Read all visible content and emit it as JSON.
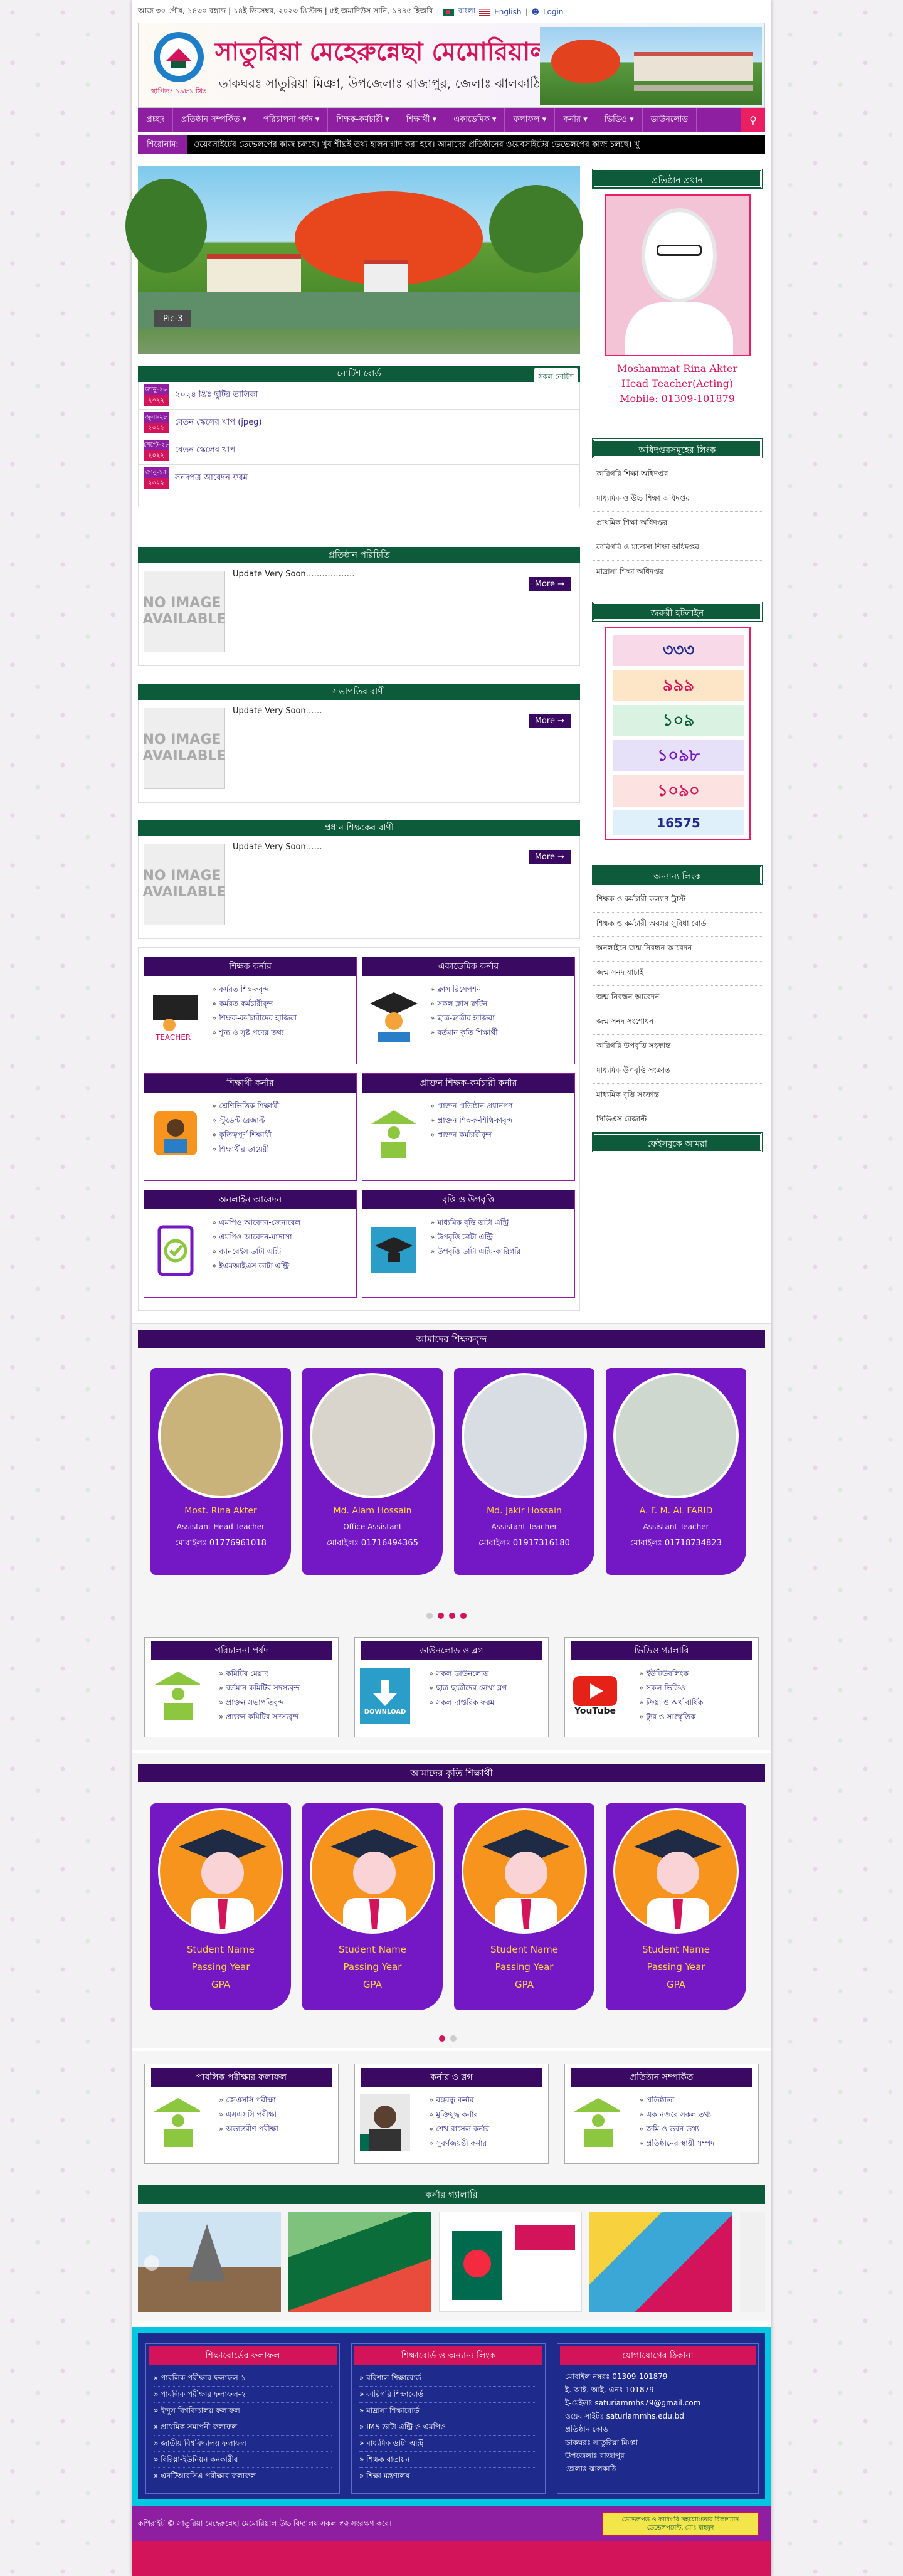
{
  "topbar": {
    "date_text": "আজ ৩০ পৌষ, ১৪৩০ বঙ্গাব্দ | ১৪ই ডিসেম্বর, ২০২৩ খ্রিস্টাব্দ | ৫ই জমাদিউস সানি, ১৪৪৫ হিজরি",
    "lang_bangla": "বাংলা",
    "lang_english": "English",
    "login": "Login"
  },
  "header": {
    "school_name": "সাতুরিয়া মেহেরুন্নেছা মেমোরিয়াল উচ্চ বিদ্যালয়",
    "address": "ডাকঘরঃ সাতুরিয়া মিঞা, উপজেলাঃ রাজাপুর, জেলাঃ ঝালকাঠি",
    "estd": "স্থাপিতঃ ১৯৮১ খ্রিঃ"
  },
  "nav": {
    "items": [
      "প্রচ্ছদ",
      "প্রতিষ্ঠান সম্পর্কিত ▾",
      "পরিচালনা পর্ষদ ▾",
      "শিক্ষক-কর্মচারী ▾",
      "শিক্ষার্থী ▾",
      "একাডেমিক ▾",
      "ফলাফল ▾",
      "কর্নার ▾",
      "ভিডিও ▾",
      "ডাউনলোড"
    ]
  },
  "ticker": {
    "label": "শিরোনাম:",
    "text": "ওয়েবসাইটের ডেভেলপের কাজ চলছে। খুব শীঘ্রই তথ্য হালনাগাদ করা হবে।        আমাদের প্রতিষ্ঠানের ওয়েবসাইটের ডেভেলপের কাজ চলছে। খু"
  },
  "slider": {
    "caption": "Pic-3"
  },
  "notice": {
    "title": "নোটিশ বোর্ড",
    "all_label": "সকল নোটিশ",
    "items": [
      {
        "day": "জানু-২৮",
        "year": "২০২২",
        "title": "২০২৪ খ্রিঃ ছুটির তালিকা"
      },
      {
        "day": "জুলা-২৮",
        "year": "২০২২",
        "title": "বেতন স্কেলের খাপ (jpeg)"
      },
      {
        "day": "সেপ্টে-২৮",
        "year": "২০২২",
        "title": "বেতন স্কেলের খাপ"
      },
      {
        "day": "জানু-১৫",
        "year": "২০২২",
        "title": "সনদপত্র আবেদন ফরম"
      }
    ]
  },
  "intro_blocks": [
    {
      "title": "প্রতিষ্ঠান পরিচিতি",
      "text": "Update Very Soon………………",
      "more": "More →",
      "noimg": "NO IMAGE AVAILABLE"
    },
    {
      "title": "সভাপতির বাণী",
      "text": "Update Very Soon……",
      "more": "More →",
      "noimg": "NO IMAGE AVAILABLE"
    },
    {
      "title": "প্রধান শিক্ষকের বাণী",
      "text": "Update Very Soon……",
      "more": "More →",
      "noimg": "NO IMAGE AVAILABLE"
    }
  ],
  "sidebar": {
    "head_title": "প্রতিষ্ঠান প্রধান",
    "head_name": "Moshammat Rina Akter",
    "head_role": "Head Teacher(Acting)",
    "head_mobile": "Mobile: 01309-101879",
    "links_title": "অধিদপ্তরসমূহের লিংক",
    "links": [
      "কারিগরি শিক্ষা অধিদপ্তর",
      "মাধ্যমিক ও উচ্চ শিক্ষা অধিদপ্তর",
      "প্রাথমিক শিক্ষা অধিদপ্তর",
      "কারিগরি ও মাদ্রাসা শিক্ষা অধিদপ্তর",
      "মাদ্রাসা শিক্ষা অধিদপ্তর"
    ],
    "hotline_title": "জরুরী হটলাইন",
    "hotline_numbers": [
      "৩৩৩",
      "৯৯৯",
      "১০৯",
      "১০৯৮",
      "১০৯০",
      "16575"
    ],
    "other_title": "অন্যান্য লিংক",
    "other_links": [
      "শিক্ষক ও কর্মচারী কল্যাণ ট্রাস্ট",
      "শিক্ষক ও কর্মচারী অবসর সুবিধা বোর্ড",
      "অনলাইনে জন্ম নিবন্ধন আবেদন",
      "জন্ম সনদ যাচাই",
      "জন্ম নিবন্ধন আবেদন",
      "জন্ম সনদ সংশোধন",
      "কারিগরি উপবৃত্তি সংক্রান্ত",
      "মাধ্যমিক উপবৃত্তি সংক্রান্ত",
      "মাধ্যমিক বৃত্তি সংক্রান্ত",
      "সিভিএস রেজাল্ট"
    ],
    "fb_title": "ফেইসবুকে আমরা"
  },
  "corners": [
    {
      "title": "শিক্ষক কর্নার",
      "items": [
        "কর্মরত শিক্ষকবৃন্দ",
        "কর্মরত কর্মচারীবৃন্দ",
        "শিক্ষক-কর্মচারীদের হাজিরা",
        "শূন্য ও সৃষ্ট পদের তথ্য"
      ]
    },
    {
      "title": "একাডেমিক কর্নার",
      "items": [
        "ক্লাস রিসেপশন",
        "সকল ক্লাস রুটিন",
        "ছাত্র-ছাত্রীর হাজিরা",
        "বর্তমান কৃতি শিক্ষার্থী"
      ]
    },
    {
      "title": "শিক্ষার্থী কর্নার",
      "items": [
        "শ্রেণিভিত্তিক শিক্ষার্থী",
        "স্টুডেন্ট রেজাল্ট",
        "কৃতিত্বপূর্ণ শিক্ষার্থী",
        "শিক্ষার্থীর ডায়েরী"
      ]
    },
    {
      "title": "প্রাক্তন শিক্ষক-কর্মচারী কর্নার",
      "items": [
        "প্রাক্তন প্রতিষ্ঠান প্রধানগণ",
        "প্রাক্তন শিক্ষক-শিক্ষিকাবৃন্দ",
        "প্রাক্তন কর্মচারীবৃন্দ"
      ]
    },
    {
      "title": "অনলাইন আবেদন",
      "items": [
        "এমপিও আবেদন-জেনারেল",
        "এমপিও আবেদন-মাদ্রাসা",
        "ব্যানবেইস ডাটা এন্ট্রি",
        "ইএমআইএস ডাটা এন্ট্রি"
      ]
    },
    {
      "title": "বৃত্তি ও উপবৃত্তি",
      "items": [
        "মাধ্যমিক বৃত্তি ডাটা এন্ট্রি",
        "উপবৃত্তি ডাটা এন্ট্রি",
        "উপবৃত্তি ডাটা এন্ট্রি-কারিগরি"
      ]
    }
  ],
  "teachers": {
    "title": "আমাদের শিক্ষকবৃন্দ",
    "list": [
      {
        "name": "Most. Rina Akter",
        "role": "Assistant Head Teacher",
        "mobile": "মোবাইলঃ 01776961018"
      },
      {
        "name": "Md. Alam Hossain",
        "role": "Office Assistant",
        "mobile": "মোবাইলঃ 01716494365"
      },
      {
        "name": "Md. Jakir Hossain",
        "role": "Assistant Teacher",
        "mobile": "মোবাইলঃ 01917316180"
      },
      {
        "name": "A. F. M. AL FARID",
        "role": "Assistant Teacher",
        "mobile": "মোবাইলঃ 01718734823"
      }
    ]
  },
  "tri1": [
    {
      "title": "পরিচালনা পর্ষদ",
      "items": [
        "কমিটির মেয়াদ",
        "বর্তমান কমিটির সদস্যবৃন্দ",
        "প্রাক্তন সভাপতিবৃন্দ",
        "প্রাক্তন কমিটির সদস্যবৃন্দ"
      ],
      "icon": "people-icon"
    },
    {
      "title": "ডাউনলোড ও ব্লগ",
      "items": [
        "সকল ডাউনলোড",
        "ছাত্র-ছাত্রীদের লেখা ব্লগ",
        "সকল দাপ্তরিক ফরম"
      ],
      "icon_label": "DOWNLOAD"
    },
    {
      "title": "ভিডিও গ্যালারি",
      "items": [
        "ইউটিউবলিংক",
        "সকল ভিডিও",
        "ক্রিয়া ও অর্থ বার্ষিক",
        "ট্যুর ও সাংস্কৃতিক"
      ],
      "icon_label": "YouTube"
    }
  ],
  "students": {
    "title": "আমাদের কৃতি শিক্ষার্থী",
    "list": [
      {
        "name": "Student Name",
        "year": "Passing Year",
        "gpa": "GPA"
      },
      {
        "name": "Student Name",
        "year": "Passing Year",
        "gpa": "GPA"
      },
      {
        "name": "Student Name",
        "year": "Passing Year",
        "gpa": "GPA"
      },
      {
        "name": "Student Name",
        "year": "Passing Year",
        "gpa": "GPA"
      }
    ]
  },
  "tri2": [
    {
      "title": "পাবলিক পরীক্ষার ফলাফল",
      "items": [
        "জেএসসি পরীক্ষা",
        "এসএসসি পরীক্ষা",
        "অভ্যন্তরীণ পরীক্ষা"
      ]
    },
    {
      "title": "কর্নার ও ব্লগ",
      "items": [
        "বঙ্গবন্ধু কর্নার",
        "মুক্তিযুদ্ধ কর্নার",
        "শেখ রাসেল কর্নার",
        "সুবর্ণজয়ন্তী কর্নার"
      ]
    },
    {
      "title": "প্রতিষ্ঠান সম্পর্কিত",
      "items": [
        "প্রতিষ্ঠাতা",
        "এক নজরে সকল তথ্য",
        "জমি ও ভবন তথ্য",
        "প্রতিষ্ঠানের স্থায়ী সম্পদ"
      ]
    }
  ],
  "gallery": {
    "title": "কর্নার গ্যালারি"
  },
  "footer": {
    "col1_title": "শিক্ষাবোর্ডের ফলাফল",
    "col1": [
      "পাবলিক পরীক্ষার ফলাফল-১",
      "পাবলিক পরীক্ষার ফলাফল-২",
      "ইন্দুস বিশ্ববিদ্যালয় ফলাফল",
      "প্রাথমিক সমাপনী ফলাফল",
      "জাতীয় বিশ্ববিদ্যালয় ফলাফল",
      "বিরিয়া-ইউনিয়ন কনকারীর",
      "এনটিআরসিএ পরীক্ষার ফলাফল"
    ],
    "col2_title": "শিক্ষাবোর্ড ও অন্যান্য লিংক",
    "col2": [
      "বরিশাল শিক্ষাবোর্ড",
      "কারিগরি শিক্ষাবোর্ড",
      "মাদ্রাসা শিক্ষাবোর্ড",
      "IMS ডাটা এন্ট্রি ও এমপিও",
      "মাধ্যমিক ডাটা এন্ট্রি",
      "শিক্ষক বাতায়ন",
      "শিক্ষা মন্ত্রণালয়"
    ],
    "col3_title": "যোগাযোগের ঠিকানা",
    "col3": [
      "মোবাইল নম্বরঃ 01309-101879",
      "ই. আই. আই. এনঃ 101879",
      "ই-মেইলঃ saturiammhs79@gmail.com",
      "ওয়েব সাইটঃ saturiammhs.edu.bd",
      "প্রতিষ্ঠান কোড",
      "ডাকঘরঃ সাতুরিয়া মিঞা",
      "উপজেলাঃ রাজাপুর",
      "জেলাঃ ঝালকাঠি"
    ]
  },
  "bottom": {
    "copyright": "কপিরাইট © সাতুরিয়া মেহেরুন্নেছা মেমোরিয়াল উচ্চ বিদ্যালয় সকল স্বত্ব সংরক্ষণ করে।",
    "dev": "ডেভেলপড ও কারিগরি সহযোগিতায় বিকাশমান ডেভেলপমেন্ট, মোঃ মাহমুদ"
  }
}
